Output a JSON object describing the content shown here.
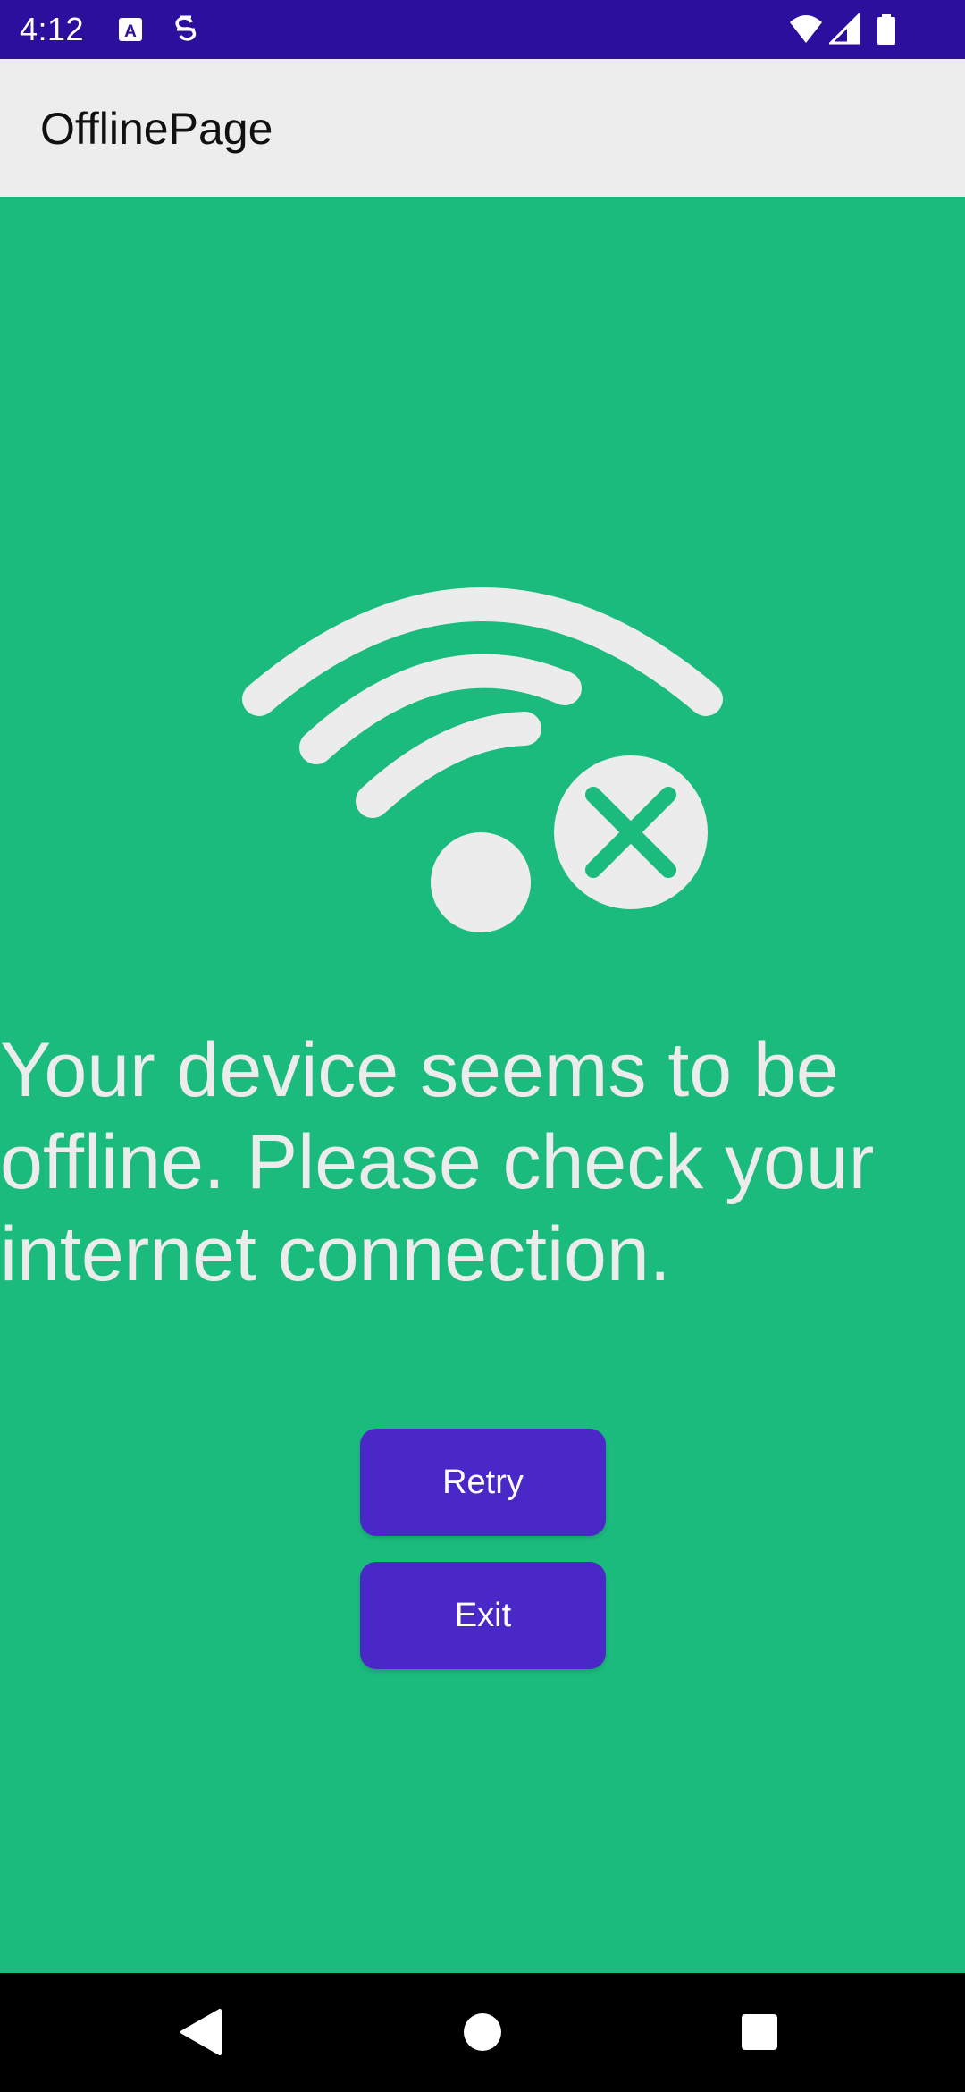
{
  "status_bar": {
    "time": "4:12",
    "icons": [
      "keyboard-a-icon",
      "sync-s-icon",
      "wifi-icon",
      "cellular-signal-icon",
      "battery-icon"
    ]
  },
  "app_bar": {
    "title": "OfflinePage"
  },
  "content": {
    "illustration_icon": "wifi-off-icon",
    "message": "Your device seems to be offline. Please check your internet connection.",
    "retry_label": "Retry",
    "exit_label": "Exit"
  },
  "nav_bar": {
    "icons": [
      "back-icon",
      "home-icon",
      "recents-icon"
    ]
  },
  "colors": {
    "status_bar": "#2D0F9E",
    "app_bar": "#EDEDED",
    "background": "#1BBA7D",
    "button": "#4A27C7",
    "illustration": "#ECECEC"
  }
}
